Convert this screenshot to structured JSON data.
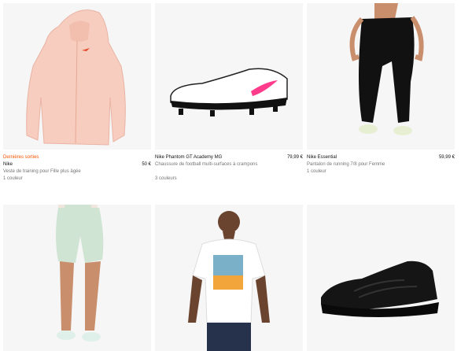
{
  "products": [
    {
      "badge": "Dernières sorties",
      "name": "Nike",
      "price": "50 €",
      "subtitle": "Veste de training pour Fille plus âgée",
      "colors": "1 couleur",
      "image": "pink-hooded-jacket"
    },
    {
      "badge": "",
      "name": "Nike Phantom GT Academy MG",
      "price": "79,99 €",
      "subtitle": "Chaussure de football multi-surfaces à crampons",
      "colors": "3 couleurs",
      "image": "white-football-boot"
    },
    {
      "badge": "",
      "name": "Nike Essential",
      "price": "59,99 €",
      "subtitle": "Pantalon de running 7/8 pour Femme",
      "colors": "1 couleur",
      "image": "black-running-pants"
    },
    {
      "image": "mint-bike-shorts"
    },
    {
      "image": "white-graphic-tshirt"
    },
    {
      "image": "black-air-max-plus-sneaker"
    }
  ],
  "colors": {
    "badge": "#fa5400",
    "text": "#111111",
    "muted": "#757575",
    "card_bg": "#f6f6f6"
  }
}
